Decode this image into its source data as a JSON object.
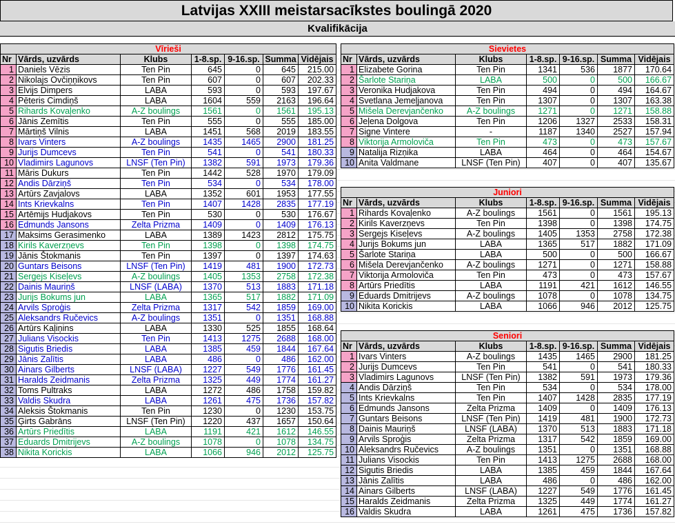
{
  "title": "Latvijas XXIII meistarsacīkstes boulingā 2020",
  "subtitle": "Kvalifikācija",
  "headers": [
    "Nr",
    "Vārds, uzvārds",
    "Klubs",
    "1-8.sp.",
    "9-16.sp.",
    "Summa",
    "Vidējais"
  ],
  "colors": {
    "blue": "#0000cc",
    "green": "#00a050",
    "pink": "#ff99cc",
    "lavender": "#b8b8e0",
    "header": "#d9d9d9",
    "section": "#ff0000"
  },
  "men": {
    "title": "Vīrieši",
    "rows": [
      [
        "1",
        "Daniels Vēzis",
        "Ten Pin",
        "645",
        "0",
        "645",
        "215.00",
        "k",
        "pk"
      ],
      [
        "2",
        "Nikolajs Ovčiņņikovs",
        "Ten Pin",
        "607",
        "0",
        "607",
        "202.33",
        "k",
        "pk"
      ],
      [
        "3",
        "Elvijs Dimpers",
        "LABA",
        "593",
        "0",
        "593",
        "197.67",
        "k",
        "pk"
      ],
      [
        "4",
        "Pēteris Cimdiņš",
        "LABA",
        "1604",
        "559",
        "2163",
        "196.64",
        "k",
        "pk"
      ],
      [
        "5",
        "Rihards Kovaļenko",
        "A-Z boulings",
        "1561",
        "0",
        "1561",
        "195.13",
        "g",
        "pk"
      ],
      [
        "6",
        "Jānis Zemītis",
        "Ten Pin",
        "555",
        "0",
        "555",
        "185.00",
        "k",
        "pk"
      ],
      [
        "7",
        "Mārtiņš Vilnis",
        "LABA",
        "1451",
        "568",
        "2019",
        "183.55",
        "k",
        "pk"
      ],
      [
        "8",
        "Ivars Vinters",
        "A-Z boulings",
        "1435",
        "1465",
        "2900",
        "181.25",
        "b",
        "pk"
      ],
      [
        "9",
        "Jurijs Dumcevs",
        "Ten Pin",
        "541",
        "0",
        "541",
        "180.33",
        "b",
        "pk"
      ],
      [
        "10",
        "Vladimirs Lagunovs",
        "LNSF (Ten Pin)",
        "1382",
        "591",
        "1973",
        "179.36",
        "b",
        "pk"
      ],
      [
        "11",
        "Māris Dukurs",
        "Ten Pin",
        "1442",
        "528",
        "1970",
        "179.09",
        "k",
        "pk"
      ],
      [
        "12",
        "Andis Dārziņš",
        "Ten Pin",
        "534",
        "0",
        "534",
        "178.00",
        "b",
        "pk"
      ],
      [
        "13",
        "Artūrs Zavjalovs",
        "LABA",
        "1352",
        "601",
        "1953",
        "177.55",
        "k",
        "pk"
      ],
      [
        "14",
        "Ints Krievkalns",
        "Ten Pin",
        "1407",
        "1428",
        "2835",
        "177.19",
        "b",
        "pk"
      ],
      [
        "15",
        "Artēmijs Hudjakovs",
        "Ten Pin",
        "530",
        "0",
        "530",
        "176.67",
        "k",
        "pk"
      ],
      [
        "16",
        "Edmunds Jansons",
        "Zelta Prizma",
        "1409",
        "0",
        "1409",
        "176.13",
        "b",
        "pk"
      ],
      [
        "17",
        "Maksims Gerasimenko",
        "LABA",
        "1389",
        "1423",
        "2812",
        "175.75",
        "k",
        "bl"
      ],
      [
        "18",
        "Kirils Kaverzņevs",
        "Ten Pin",
        "1398",
        "0",
        "1398",
        "174.75",
        "g",
        "bl"
      ],
      [
        "19",
        "Jānis Štokmanis",
        "Ten Pin",
        "1397",
        "0",
        "1397",
        "174.63",
        "k",
        "bl"
      ],
      [
        "20",
        "Guntars Beisons",
        "LNSF (Ten Pin)",
        "1419",
        "481",
        "1900",
        "172.73",
        "b",
        "bl"
      ],
      [
        "21",
        "Sergejs Kiseļevs",
        "A-Z boulings",
        "1405",
        "1353",
        "2758",
        "172.38",
        "g",
        "bl"
      ],
      [
        "22",
        "Dainis Mauriņš",
        "LNSF (LABA)",
        "1370",
        "513",
        "1883",
        "171.18",
        "b",
        "bl"
      ],
      [
        "23",
        "Jurijs Bokums jun",
        "LABA",
        "1365",
        "517",
        "1882",
        "171.09",
        "g",
        "bl"
      ],
      [
        "24",
        "Arvils Sproģis",
        "Zelta Prizma",
        "1317",
        "542",
        "1859",
        "169.00",
        "b",
        "bl"
      ],
      [
        "25",
        "Aleksandrs Ručevics",
        "A-Z boulings",
        "1351",
        "0",
        "1351",
        "168.88",
        "b",
        "bl"
      ],
      [
        "26",
        "Artūrs Kaļiņins",
        "LABA",
        "1330",
        "525",
        "1855",
        "168.64",
        "k",
        "bl"
      ],
      [
        "27",
        "Julians Visockis",
        "Ten Pin",
        "1413",
        "1275",
        "2688",
        "168.00",
        "b",
        "bl"
      ],
      [
        "28",
        "Sigutis Briedis",
        "LABA",
        "1385",
        "459",
        "1844",
        "167.64",
        "b",
        "bl"
      ],
      [
        "29",
        "Jānis Zalītis",
        "LABA",
        "486",
        "0",
        "486",
        "162.00",
        "b",
        "bl"
      ],
      [
        "30",
        "Ainars Gilberts",
        "LNSF (LABA)",
        "1227",
        "549",
        "1776",
        "161.45",
        "b",
        "bl"
      ],
      [
        "31",
        "Haralds Zeidmanis",
        "Zelta Prizma",
        "1325",
        "449",
        "1774",
        "161.27",
        "b",
        "bl"
      ],
      [
        "32",
        "Toms Pultraks",
        "LABA",
        "1272",
        "486",
        "1758",
        "159.82",
        "k",
        "bl"
      ],
      [
        "33",
        "Valdis Skudra",
        "LABA",
        "1261",
        "475",
        "1736",
        "157.82",
        "b",
        "bl"
      ],
      [
        "34",
        "Aleksis Štokmanis",
        "Ten Pin",
        "1230",
        "0",
        "1230",
        "153.75",
        "k",
        "bl"
      ],
      [
        "35",
        "Ģirts Gabrāns",
        "LNSF (Ten Pin)",
        "1220",
        "437",
        "1657",
        "150.64",
        "k",
        "bl"
      ],
      [
        "36",
        "Artūrs Priedītis",
        "LABA",
        "1191",
        "421",
        "1612",
        "146.55",
        "g",
        "bl"
      ],
      [
        "37",
        "Eduards Dmitrijevs",
        "A-Z boulings",
        "1078",
        "0",
        "1078",
        "134.75",
        "g",
        "bl"
      ],
      [
        "38",
        "Nikita Korickis",
        "LABA",
        "1066",
        "946",
        "2012",
        "125.75",
        "g",
        "bl"
      ]
    ]
  },
  "women": {
    "title": "Sievietes",
    "rows": [
      [
        "1",
        "Elizabete Gorina",
        "Ten Pin",
        "1341",
        "536",
        "1877",
        "170.64",
        "k",
        "pk"
      ],
      [
        "2",
        "Šarlote Stariņa",
        "LABA",
        "500",
        "0",
        "500",
        "166.67",
        "g",
        "pk"
      ],
      [
        "3",
        "Veronika Hudjakova",
        "Ten Pin",
        "494",
        "0",
        "494",
        "164.67",
        "k",
        "pk"
      ],
      [
        "4",
        "Svetlana Jemeļjanova",
        "Ten Pin",
        "1307",
        "0",
        "1307",
        "163.38",
        "k",
        "pk"
      ],
      [
        "5",
        "Mišela Derevjančenko",
        "A-Z boulings",
        "1271",
        "0",
        "1271",
        "158.88",
        "g",
        "pk"
      ],
      [
        "6",
        "Jeļena Dolgova",
        "Ten Pin",
        "1206",
        "1327",
        "2533",
        "158.31",
        "k",
        "pk"
      ],
      [
        "7",
        "Signe Vintere",
        "-",
        "1187",
        "1340",
        "2527",
        "157.94",
        "k",
        "pk"
      ],
      [
        "8",
        "Viktorija Armoloviča",
        "Ten Pin",
        "473",
        "0",
        "473",
        "157.67",
        "g",
        "pk"
      ],
      [
        "9",
        "Natalija Rizņika",
        "LABA",
        "464",
        "0",
        "464",
        "154.67",
        "k",
        "bl"
      ],
      [
        "10",
        "Anita Valdmane",
        "LNSF (Ten Pin)",
        "407",
        "0",
        "407",
        "135.67",
        "k",
        "bl"
      ]
    ]
  },
  "juniors": {
    "title": "Juniori",
    "rows": [
      [
        "1",
        "Rihards Kovaļenko",
        "A-Z boulings",
        "1561",
        "0",
        "1561",
        "195.13",
        "k",
        "pk"
      ],
      [
        "2",
        "Kirils Kaverzņevs",
        "Ten Pin",
        "1398",
        "0",
        "1398",
        "174.75",
        "k",
        "pk"
      ],
      [
        "3",
        "Sergejs Kiseļevs",
        "A-Z boulings",
        "1405",
        "1353",
        "2758",
        "172.38",
        "k",
        "pk"
      ],
      [
        "4",
        "Jurijs Bokums jun",
        "LABA",
        "1365",
        "517",
        "1882",
        "171.09",
        "k",
        "pk"
      ],
      [
        "5",
        "Šarlote Stariņa",
        "LABA",
        "500",
        "0",
        "500",
        "166.67",
        "k",
        "pk"
      ],
      [
        "6",
        "Mišela Derevjančenko",
        "A-Z boulings",
        "1271",
        "0",
        "1271",
        "158.88",
        "k",
        "pk"
      ],
      [
        "7",
        "Viktorija Armoloviča",
        "Ten Pin",
        "473",
        "0",
        "473",
        "157.67",
        "k",
        "pk"
      ],
      [
        "8",
        "Artūrs Priedītis",
        "LABA",
        "1191",
        "421",
        "1612",
        "146.55",
        "k",
        "pk"
      ],
      [
        "9",
        "Eduards Dmitrijevs",
        "A-Z boulings",
        "1078",
        "0",
        "1078",
        "134.75",
        "k",
        "bl"
      ],
      [
        "10",
        "Nikita Korickis",
        "LABA",
        "1066",
        "946",
        "2012",
        "125.75",
        "k",
        "bl"
      ]
    ]
  },
  "seniors": {
    "title": "Seniori",
    "rows": [
      [
        "1",
        "Ivars Vinters",
        "A-Z boulings",
        "1435",
        "1465",
        "2900",
        "181.25",
        "k",
        "pk"
      ],
      [
        "2",
        "Jurijs Dumcevs",
        "Ten Pin",
        "541",
        "0",
        "541",
        "180.33",
        "k",
        "pk"
      ],
      [
        "3",
        "Vladimirs Lagunovs",
        "LNSF (Ten Pin)",
        "1382",
        "591",
        "1973",
        "179.36",
        "k",
        "pk"
      ],
      [
        "4",
        "Andis Dārziņš",
        "Ten Pin",
        "534",
        "0",
        "534",
        "178.00",
        "k",
        "bl"
      ],
      [
        "5",
        "Ints Krievkalns",
        "Ten Pin",
        "1407",
        "1428",
        "2835",
        "177.19",
        "k",
        "bl"
      ],
      [
        "6",
        "Edmunds Jansons",
        "Zelta Prizma",
        "1409",
        "0",
        "1409",
        "176.13",
        "k",
        "bl"
      ],
      [
        "7",
        "Guntars Beisons",
        "LNSF (Ten Pin)",
        "1419",
        "481",
        "1900",
        "172.73",
        "k",
        "bl"
      ],
      [
        "8",
        "Dainis Mauriņš",
        "LNSF (LABA)",
        "1370",
        "513",
        "1883",
        "171.18",
        "k",
        "bl"
      ],
      [
        "9",
        "Arvils Sproģis",
        "Zelta Prizma",
        "1317",
        "542",
        "1859",
        "169.00",
        "k",
        "bl"
      ],
      [
        "10",
        "Aleksandrs Ručevics",
        "A-Z boulings",
        "1351",
        "0",
        "1351",
        "168.88",
        "k",
        "bl"
      ],
      [
        "11",
        "Julians Visockis",
        "Ten Pin",
        "1413",
        "1275",
        "2688",
        "168.00",
        "k",
        "bl"
      ],
      [
        "12",
        "Sigutis Briedis",
        "LABA",
        "1385",
        "459",
        "1844",
        "167.64",
        "k",
        "bl"
      ],
      [
        "13",
        "Jānis Zalītis",
        "LABA",
        "486",
        "0",
        "486",
        "162.00",
        "k",
        "bl"
      ],
      [
        "14",
        "Ainars Gilberts",
        "LNSF (LABA)",
        "1227",
        "549",
        "1776",
        "161.45",
        "k",
        "bl"
      ],
      [
        "15",
        "Haralds Zeidmanis",
        "Zelta Prizma",
        "1325",
        "449",
        "1774",
        "161.27",
        "k",
        "bl"
      ],
      [
        "16",
        "Valdis Skudra",
        "LABA",
        "1261",
        "475",
        "1736",
        "157.82",
        "k",
        "bl"
      ]
    ]
  }
}
